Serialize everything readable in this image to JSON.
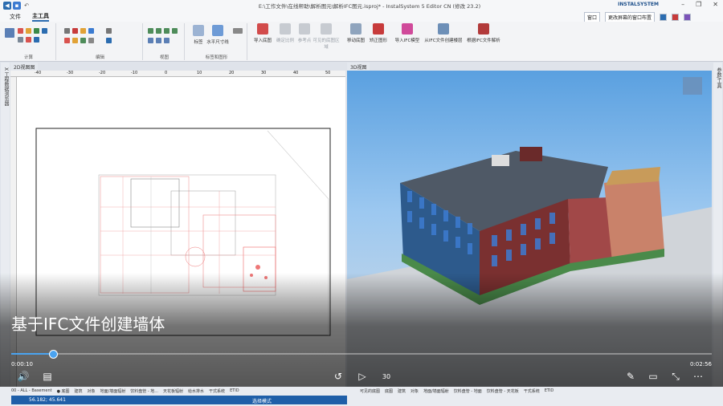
{
  "window": {
    "title": "E:\\工作文件\\在线帮助\\解析图元\\解析IFC图元.isproj* - InstalSystem 5 Editor CN (修改 23.2)",
    "brand": "INSTALSYSTEM"
  },
  "menu": {
    "tabs": [
      "文件",
      "主工具"
    ],
    "active": "主工具"
  },
  "right_menu": {
    "window": "窗口",
    "layout": "更改屏幕的窗口布置"
  },
  "ribbon": {
    "groups": [
      "计算",
      "编辑",
      "视图",
      "标签和图形"
    ],
    "buttons": [
      "标签",
      "水平尺寸线",
      "导入底图",
      "确定比例",
      "参考点",
      "可见的底图区域",
      "移动底图",
      "矫正图形",
      "导入IFC模型",
      "从IFC文件创建楼层",
      "根据IFC文件解析"
    ],
    "disabled": [
      "确定比例",
      "参考点",
      "可见的底图区域"
    ]
  },
  "panels": {
    "left_title": "2D视图图",
    "right_title": "3D视图",
    "left_side": "X 工程数据浏览器",
    "right_side": "参数/工具"
  },
  "ruler_ticks": [
    "-40",
    "-30",
    "-20",
    "-10",
    "0",
    "10",
    "20",
    "30",
    "40",
    "50"
  ],
  "video": {
    "subtitle": "基于IFC文件创建墙体",
    "current": "0:00:10",
    "duration": "0:02:56",
    "progress": 0.06,
    "speed_label": "30"
  },
  "status": {
    "left_items": [
      "00 - ALL - Basement",
      "● 底图",
      "建筑",
      "对象",
      "地面/墙面辐射",
      "饮料盘管 - 地...",
      "天花板辐射",
      "给水排水",
      "干式系统",
      "ETID"
    ],
    "right_items": [
      "可见的底图",
      "底图",
      "建筑",
      "对象",
      "地面/墙面辐射",
      "饮料盘管 - 地面",
      "饮料盘管 - 天花板",
      "干式系统",
      "ETID"
    ],
    "coords": "56.182; 45.641",
    "mode": "选择模式"
  },
  "icons": [
    "back-icon",
    "save-icon",
    "close-icon",
    "play-icon",
    "volume-icon",
    "subtitles-icon",
    "rewind-icon",
    "forward-icon",
    "edit-icon",
    "pip-icon",
    "fullscreen-icon",
    "more-icon"
  ]
}
